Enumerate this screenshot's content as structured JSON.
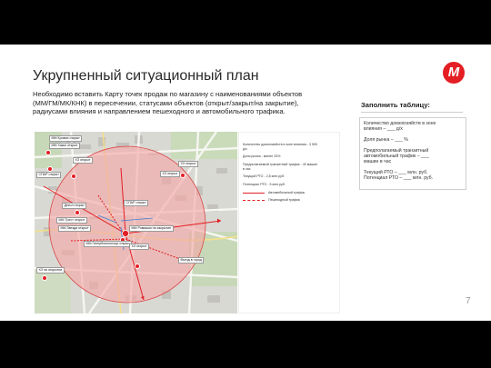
{
  "slide": {
    "title": "Укрупненный ситуационный план",
    "logo_letter": "М",
    "description": [
      "Необходимо вставить Карту точек продаж по магазину с наименованиями объектов",
      "(ММ/ГМ/МК/КНК) в пересечении, статусами объектов (открыт/закрыт/на закрытие),",
      "радиусами влияния и направлением пешеходного и автомобильного трафика."
    ],
    "page_number": "7"
  },
  "map": {
    "labels": [
      {
        "text": "ММ Крокмэ открыт"
      },
      {
        "text": "ММ Хакко открыт"
      },
      {
        "text": "ХЗ открыт"
      },
      {
        "text": "СПАР открыт"
      },
      {
        "text": "Декол открыт"
      },
      {
        "text": "ММ Трест открыт"
      },
      {
        "text": "ММ Звезда открыт"
      },
      {
        "text": "ММ Гипербольногоце открыт"
      },
      {
        "text": "ХЗ открыт"
      },
      {
        "text": "ХЗ на открытие"
      },
      {
        "text": "ХЗ открыт"
      },
      {
        "text": "ХЗ открыт"
      },
      {
        "text": "СПАР открыт"
      },
      {
        "text": "ММ Ромашки на закрытие"
      },
      {
        "text": "Въезд в город"
      }
    ]
  },
  "legend": {
    "lines": [
      "Количество домохозяйств в зоне влияния - 3 500",
      "д/х",
      "Доля рынка - менее 33%",
      "Предполагаемый транзитный трафик - 40 машин",
      "в час",
      "Текущий РТО - 2,8 млн.руб.",
      "Потенциал РТО - 5 млн.руб."
    ],
    "traffic": [
      {
        "label": "Автомобильный трафик",
        "kind": "car"
      },
      {
        "label": "Пешеходный трафик",
        "kind": "pedestrian"
      }
    ]
  },
  "fill_table": {
    "heading": "Заполнить таблицу:",
    "lines": [
      "Количество домохозяйств в зоне",
      "влияния – ___ д/х",
      "",
      "Доля рынка – ___ %",
      "",
      "Предполагаемый транзитный",
      "автомобильный трафик – ___",
      "машин в час",
      "",
      "Текущий РТО – ___ млн. руб.",
      "Потенциал РТО – ___ млн. руб."
    ]
  },
  "colors": {
    "accent": "#e31e24",
    "circle_fill": "#f4a6a6"
  }
}
